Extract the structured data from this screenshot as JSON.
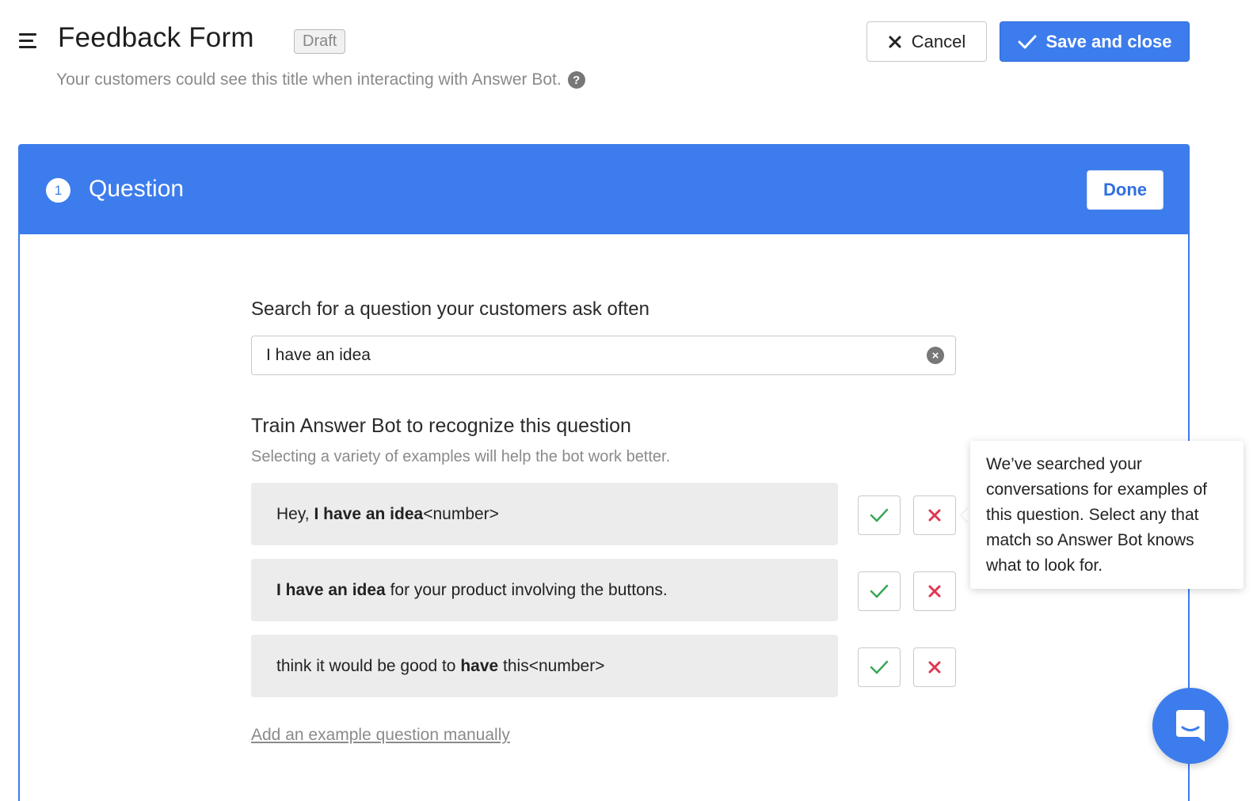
{
  "header": {
    "title": "Feedback Form",
    "status_badge": "Draft",
    "subtitle": "Your customers could see this title when interacting with Answer Bot.",
    "help_icon_glyph": "?",
    "cancel_label": "Cancel",
    "save_label": "Save and close"
  },
  "panel": {
    "step_number": "1",
    "title": "Question",
    "done_label": "Done"
  },
  "search": {
    "label": "Search for a question your customers ask often",
    "value": "I have an idea",
    "clear_icon_glyph": "×"
  },
  "training": {
    "title": "Train Answer Bot to recognize this question",
    "help": "Selecting a variety of examples will help the bot work better.",
    "examples": [
      {
        "before": "Hey, ",
        "bold": "I have an idea",
        "after": "<number>"
      },
      {
        "before": "",
        "bold": "I have an idea",
        "after": " for your product involving the buttons."
      },
      {
        "before": "think it would be good to ",
        "bold": "have",
        "after": " this<number>"
      }
    ],
    "tooltip": "We’ve searched your conversations for examples of this question. Select any that match so Answer Bot knows what to look for.",
    "add_manual_link": "Add an example question manually"
  },
  "colors": {
    "accent": "#3d7cec",
    "accept_green": "#3aa757",
    "reject_red": "#e0364f"
  },
  "icons": [
    "menu-icon",
    "close-icon",
    "check-icon",
    "help-icon",
    "clear-icon",
    "chat-icon"
  ]
}
